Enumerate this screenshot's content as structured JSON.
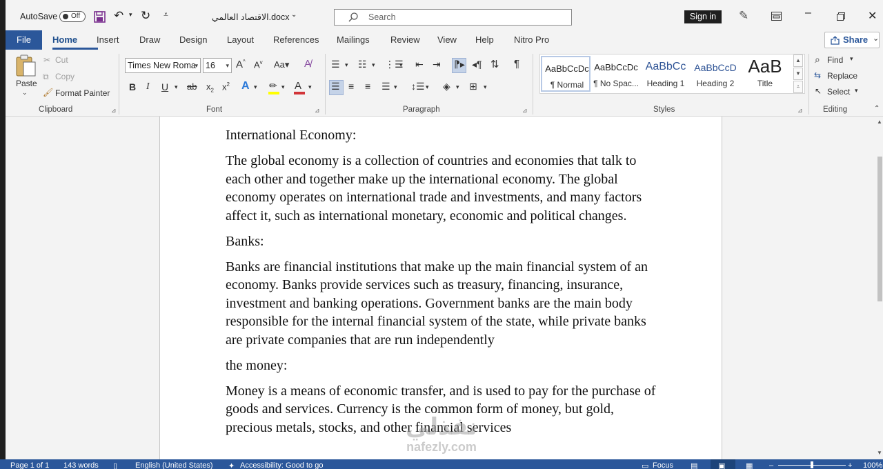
{
  "titlebar": {
    "autosave_label": "AutoSave",
    "autosave_state": "Off",
    "doc_title": "الاقتصاد العالمي.docx",
    "search_placeholder": "Search",
    "signin_label": "Sign in"
  },
  "tabs": [
    "File",
    "Home",
    "Insert",
    "Draw",
    "Design",
    "Layout",
    "References",
    "Mailings",
    "Review",
    "View",
    "Help",
    "Nitro Pro"
  ],
  "active_tab": "Home",
  "share_label": "Share",
  "clipboard": {
    "paste": "Paste",
    "cut": "Cut",
    "copy": "Copy",
    "format_painter": "Format Painter",
    "group": "Clipboard"
  },
  "font": {
    "name": "Times New Roma",
    "size": "16",
    "group": "Font"
  },
  "paragraph": {
    "group": "Paragraph"
  },
  "styles": {
    "group": "Styles",
    "items": [
      {
        "preview": "AaBbCcDc",
        "name": "¶ Normal"
      },
      {
        "preview": "AaBbCcDc",
        "name": "¶ No Spac..."
      },
      {
        "preview": "AaBbCc",
        "name": "Heading 1"
      },
      {
        "preview": "AaBbCcD",
        "name": "Heading 2"
      },
      {
        "preview": "AaB",
        "name": "Title"
      }
    ]
  },
  "editing": {
    "find": "Find",
    "replace": "Replace",
    "select": "Select",
    "group": "Editing"
  },
  "document": {
    "paragraphs": [
      "International Economy:",
      "The global economy is a collection of countries and economies that talk to each other and together make up the international economy. The global economy operates on international trade and investments, and many factors affect it, such as international monetary, economic and political changes.",
      "Banks:",
      "Banks are financial institutions that make up the main financial system of an economy. Banks provide services such as treasury, financing, insurance, investment and banking operations. Government banks are the main body responsible for the internal financial system of the state, while private banks are private companies that are run independently",
      "the money:",
      "Money is a means of economic transfer, and is used to pay for the purchase of goods and services. Currency is the common form of money, but gold, precious metals, stocks, and other financial services"
    ]
  },
  "status": {
    "page": "Page 1 of 1",
    "words": "143 words",
    "language": "English (United States)",
    "accessibility": "Accessibility: Good to go",
    "focus": "Focus",
    "zoom": "100%"
  },
  "watermark": {
    "line1": "نفذلي",
    "line2": "nafezly.com"
  },
  "colors": {
    "accent": "#2b579a",
    "font_color_bar": "#d13438",
    "highlight_bar": "#ffff00"
  }
}
